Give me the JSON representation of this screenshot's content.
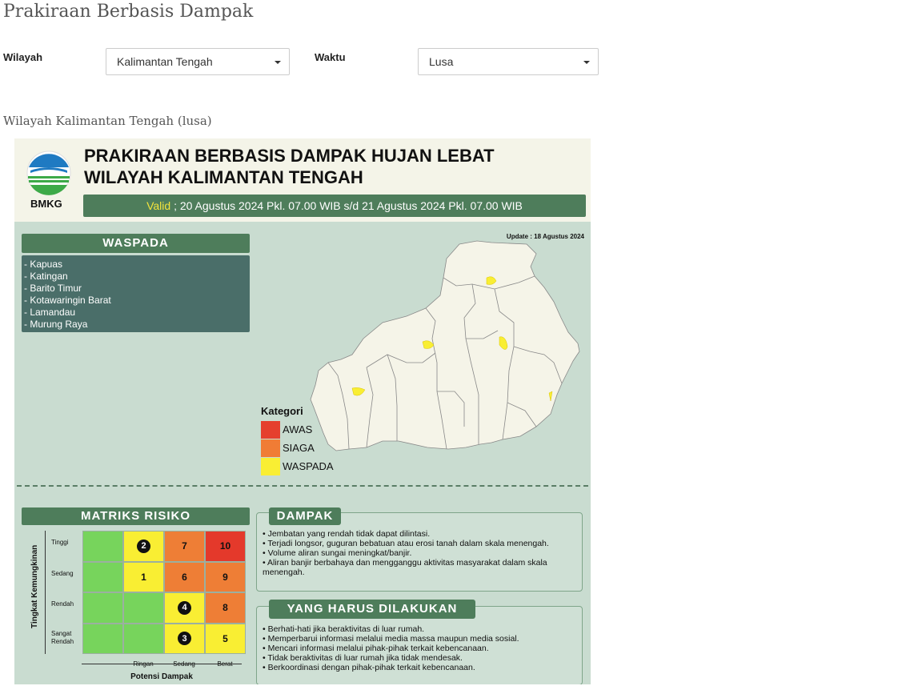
{
  "page": {
    "title": "Prakiraan Berbasis Dampak",
    "subheading": "Wilayah Kalimantan Tengah (lusa)"
  },
  "filters": {
    "wilayah_label": "Wilayah",
    "wilayah_value": "Kalimantan Tengah",
    "waktu_label": "Waktu",
    "waktu_value": "Lusa"
  },
  "infographic": {
    "logo_text": "BMKG",
    "title_line1": "PRAKIRAAN BERBASIS DAMPAK HUJAN LEBAT",
    "title_line2": "WILAYAH KALIMANTAN TENGAH",
    "valid_word": "Valid",
    "valid_text": " ; 20 Agustus 2024 Pkl. 07.00 WIB s/d 21 Agustus 2024 Pkl. 07.00 WIB",
    "update": "Update : 18 Agustus 2024",
    "waspada_title": "WASPADA",
    "waspada_items": [
      "- Kapuas",
      "- Katingan",
      "- Barito Timur",
      "- Kotawaringin Barat",
      "- Lamandau",
      "- Murung Raya"
    ],
    "legend": {
      "title": "Kategori",
      "items": [
        {
          "label": "AWAS",
          "color": "#e53f2e"
        },
        {
          "label": "SIAGA",
          "color": "#f07c35"
        },
        {
          "label": "WASPADA",
          "color": "#f9ee33"
        }
      ]
    },
    "matrix": {
      "title": "MATRIKS RISIKO",
      "y_axis_title": "Tingkat Kemungkinan",
      "x_axis_title": "Potensi Dampak",
      "row_labels": [
        "Tinggi",
        "Sedang",
        "Rendah",
        "Sangat Rendah"
      ],
      "col_labels": [
        "Ringan",
        "Sedang",
        "Berat"
      ],
      "colors": {
        "green": "#77d45c",
        "yellow": "#f9ee33",
        "orange": "#ee7e36",
        "red": "#e4392b"
      },
      "rows": [
        [
          {
            "v": "",
            "c": "green"
          },
          {
            "v": "2",
            "c": "yellow",
            "circle": true
          },
          {
            "v": "7",
            "c": "orange"
          },
          {
            "v": "10",
            "c": "red"
          }
        ],
        [
          {
            "v": "",
            "c": "green"
          },
          {
            "v": "1",
            "c": "yellow"
          },
          {
            "v": "6",
            "c": "orange"
          },
          {
            "v": "9",
            "c": "orange"
          }
        ],
        [
          {
            "v": "",
            "c": "green"
          },
          {
            "v": "",
            "c": "green"
          },
          {
            "v": "4",
            "c": "yellow",
            "circle": true
          },
          {
            "v": "8",
            "c": "orange"
          }
        ],
        [
          {
            "v": "",
            "c": "green"
          },
          {
            "v": "",
            "c": "green"
          },
          {
            "v": "3",
            "c": "yellow",
            "circle": true
          },
          {
            "v": "5",
            "c": "yellow"
          }
        ]
      ]
    },
    "dampak": {
      "title": "DAMPAK",
      "items": [
        "• Jembatan yang rendah tidak dapat dilintasi.",
        "• Terjadi longsor, guguran bebatuan atau erosi tanah dalam skala menengah.",
        "• Volume aliran sungai meningkat/banjir.",
        "• Aliran banjir berbahaya dan mengganggu aktivitas masyarakat dalam skala menengah."
      ]
    },
    "harus": {
      "title": "YANG HARUS DILAKUKAN",
      "items": [
        "• Berhati-hati jika beraktivitas di luar rumah.",
        "• Memperbarui informasi melalui media massa maupun media sosial.",
        "• Mencari informasi melalui pihak-pihak terkait kebencanaan.",
        "• Tidak beraktivitas di luar rumah jika tidak mendesak.",
        "• Berkoordinasi dengan pihak-pihak terkait kebencanaan."
      ]
    }
  }
}
